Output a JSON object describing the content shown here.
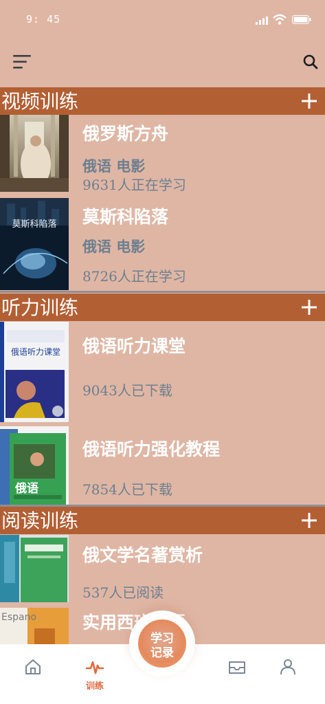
{
  "status_bar": {
    "time": "9: 45"
  },
  "sections": [
    {
      "title": "视频训练",
      "items": [
        {
          "name": "俄罗斯方舟",
          "tag": "俄语 电影",
          "stat": "9631人正在学习"
        },
        {
          "name": "莫斯科陷落",
          "tag": "俄语 电影",
          "stat": "8726人正在学习",
          "cover_text": "莫斯科陷落"
        }
      ]
    },
    {
      "title": "听力训练",
      "items": [
        {
          "name": "俄语听力课堂",
          "stat": "9043人已下载",
          "cover_text": "俄语听力课堂"
        },
        {
          "name": "俄语听力强化教程",
          "stat": "7854人已下载",
          "cover_text": "俄语"
        }
      ]
    },
    {
      "title": "阅读训练",
      "items": [
        {
          "name": "俄文学名著赏析",
          "stat": "537人已阅读"
        },
        {
          "name": "实用西班牙语",
          "cover_text": "Espano"
        }
      ]
    }
  ],
  "tabbar": {
    "tabs": [
      {
        "icon": "home-icon"
      },
      {
        "icon": "pulse-icon",
        "label": "训练"
      },
      {
        "icon": "inbox-icon"
      },
      {
        "icon": "user-icon"
      }
    ],
    "record_label": "学习\n记录"
  },
  "colors": {
    "background": "#dfb6a4",
    "section_header": "#b35f34",
    "accent": "#e2683f",
    "muted_text": "#6d7f8f"
  }
}
